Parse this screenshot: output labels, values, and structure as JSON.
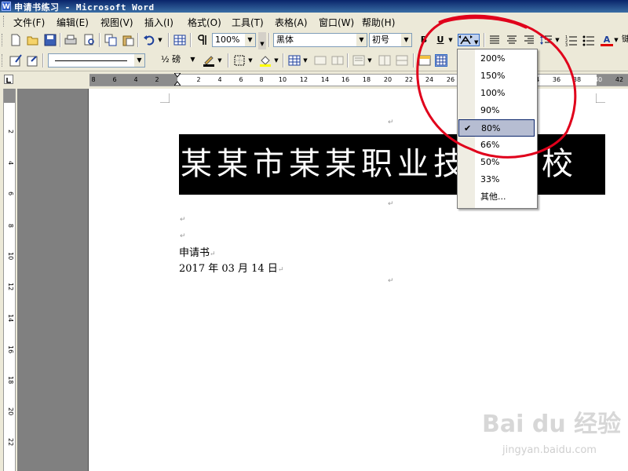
{
  "window": {
    "title": "申请书练习 - Microsoft Word",
    "icon": "word-icon"
  },
  "menu": [
    {
      "id": "file",
      "label": "文件(F)"
    },
    {
      "id": "edit",
      "label": "编辑(E)"
    },
    {
      "id": "view",
      "label": "视图(V)"
    },
    {
      "id": "insert",
      "label": "插入(I)"
    },
    {
      "id": "format",
      "label": "格式(O)"
    },
    {
      "id": "tools",
      "label": "工具(T)"
    },
    {
      "id": "table",
      "label": "表格(A)"
    },
    {
      "id": "window",
      "label": "窗口(W)"
    },
    {
      "id": "help",
      "label": "帮助(H)"
    }
  ],
  "toolbar1": {
    "zoom_value": "100%",
    "font_name": "黑体",
    "font_size": "初号",
    "bold_label": "B",
    "underline_label": "U",
    "font_color_label": "A",
    "overflow_label": "键"
  },
  "toolbar2": {
    "line_weight": "½ 磅"
  },
  "ruler": {
    "ticks": [
      "8",
      "6",
      "4",
      "2",
      "2",
      "4",
      "6",
      "8",
      "10",
      "12",
      "14",
      "16",
      "18",
      "20",
      "22",
      "24",
      "26",
      "28",
      "30",
      "32",
      "34",
      "36",
      "38",
      "40",
      "42"
    ],
    "vticks": [
      "2",
      "4",
      "6",
      "8",
      "10",
      "12",
      "14",
      "16",
      "18",
      "20",
      "22"
    ]
  },
  "document": {
    "banner_text": "某某市某某职业技术学校",
    "line1": "申请书",
    "line2": "2017 年 03 月 14 日",
    "para_mark": "↵"
  },
  "scale_menu": {
    "items": [
      "200%",
      "150%",
      "100%",
      "90%",
      "80%",
      "66%",
      "50%",
      "33%",
      "其他..."
    ],
    "selected": "80%"
  },
  "watermark": {
    "brand": "Bai du 经验",
    "url": "jingyan.baidu.com"
  },
  "colors": {
    "annotation": "#e0001b",
    "selection": "#b6bdd2",
    "banner_bg": "#000000"
  }
}
